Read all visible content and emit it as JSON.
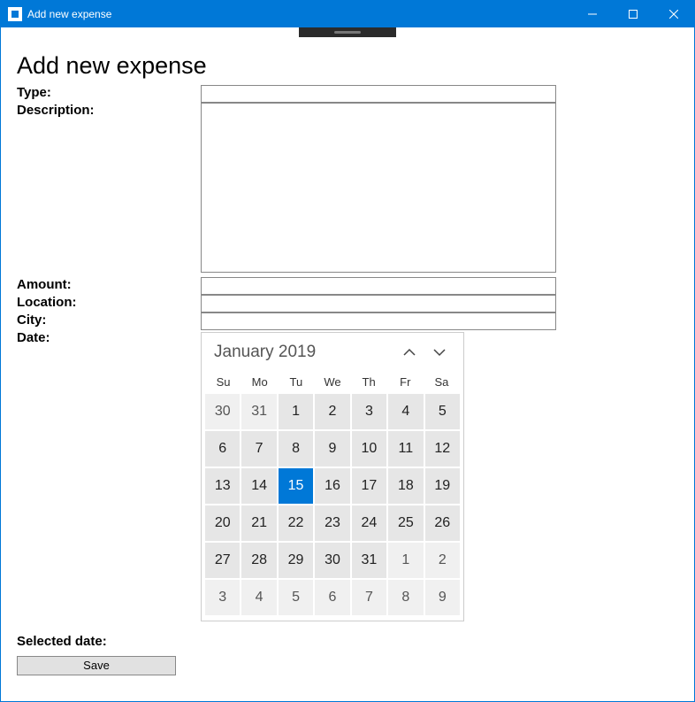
{
  "window": {
    "title": "Add new expense"
  },
  "page": {
    "heading": "Add new expense"
  },
  "form": {
    "type_label": "Type:",
    "description_label": "Description:",
    "amount_label": "Amount:",
    "location_label": "Location:",
    "city_label": "City:",
    "date_label": "Date:",
    "type_value": "",
    "description_value": "",
    "amount_value": "",
    "location_value": "",
    "city_value": ""
  },
  "calendar": {
    "month_year": "January 2019",
    "dow": [
      "Su",
      "Mo",
      "Tu",
      "We",
      "Th",
      "Fr",
      "Sa"
    ],
    "days": [
      {
        "n": "30",
        "out": true
      },
      {
        "n": "31",
        "out": true
      },
      {
        "n": "1"
      },
      {
        "n": "2"
      },
      {
        "n": "3"
      },
      {
        "n": "4"
      },
      {
        "n": "5"
      },
      {
        "n": "6"
      },
      {
        "n": "7"
      },
      {
        "n": "8"
      },
      {
        "n": "9"
      },
      {
        "n": "10"
      },
      {
        "n": "11"
      },
      {
        "n": "12"
      },
      {
        "n": "13"
      },
      {
        "n": "14"
      },
      {
        "n": "15",
        "selected": true
      },
      {
        "n": "16"
      },
      {
        "n": "17"
      },
      {
        "n": "18"
      },
      {
        "n": "19"
      },
      {
        "n": "20"
      },
      {
        "n": "21"
      },
      {
        "n": "22"
      },
      {
        "n": "23"
      },
      {
        "n": "24"
      },
      {
        "n": "25"
      },
      {
        "n": "26"
      },
      {
        "n": "27"
      },
      {
        "n": "28"
      },
      {
        "n": "29"
      },
      {
        "n": "30"
      },
      {
        "n": "31"
      },
      {
        "n": "1",
        "out": true
      },
      {
        "n": "2",
        "out": true
      },
      {
        "n": "3",
        "out": true
      },
      {
        "n": "4",
        "out": true
      },
      {
        "n": "5",
        "out": true
      },
      {
        "n": "6",
        "out": true
      },
      {
        "n": "7",
        "out": true
      },
      {
        "n": "8",
        "out": true
      },
      {
        "n": "9",
        "out": true
      }
    ]
  },
  "selected_date": {
    "label": "Selected date:",
    "value": ""
  },
  "actions": {
    "save_label": "Save"
  }
}
